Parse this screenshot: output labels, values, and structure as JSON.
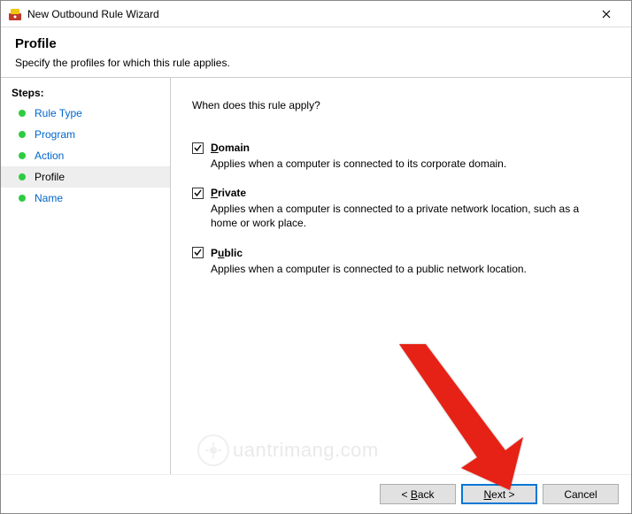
{
  "window": {
    "title": "New Outbound Rule Wizard"
  },
  "header": {
    "title": "Profile",
    "subtitle": "Specify the profiles for which this rule applies."
  },
  "sidebar": {
    "heading": "Steps:",
    "items": [
      {
        "label": "Rule Type",
        "active": false,
        "link": true
      },
      {
        "label": "Program",
        "active": false,
        "link": true
      },
      {
        "label": "Action",
        "active": false,
        "link": true
      },
      {
        "label": "Profile",
        "active": true,
        "link": false
      },
      {
        "label": "Name",
        "active": false,
        "link": true
      }
    ]
  },
  "content": {
    "question": "When does this rule apply?",
    "options": [
      {
        "accel": "D",
        "rest": "omain",
        "checked": true,
        "desc": "Applies when a computer is connected to its corporate domain."
      },
      {
        "accel": "P",
        "rest": "rivate",
        "checked": true,
        "desc": "Applies when a computer is connected to a private network location, such as a home or work place."
      },
      {
        "accel": "P",
        "rest": "ublic",
        "checked": true,
        "leading": "",
        "label_pre": "",
        "desc": "Applies when a computer is connected to a public network location.",
        "accel2": "u",
        "pre": "P",
        "post": "blic"
      }
    ]
  },
  "footer": {
    "back": {
      "pre": "< ",
      "accel": "B",
      "post": "ack"
    },
    "next": {
      "accel": "N",
      "post": "ext >"
    },
    "cancel": "Cancel"
  },
  "watermark": "uantrimang.com"
}
